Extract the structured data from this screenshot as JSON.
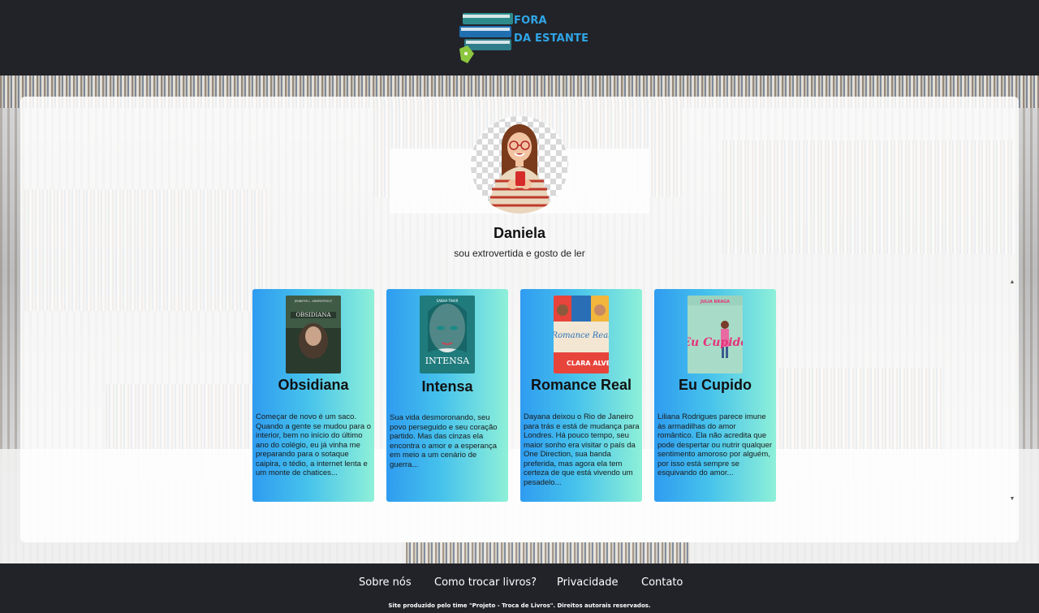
{
  "header": {
    "logo_line1": "FORA",
    "logo_line2": "DA ESTANTE"
  },
  "profile": {
    "name": "Daniela",
    "bio": "sou extrovertida e gosto de ler"
  },
  "books": [
    {
      "title": "Obsidiana",
      "description": "Começar de novo é um saco. Quando a gente se mudou para o interior, bem no início do último ano do colégio, eu já vinha me preparando para o sotaque caipira, o tédio, a internet lenta e um monte de chatices...",
      "cover_text": "OBSIDIANA",
      "cover_subtitle": "JENNIFER L. ARMENTROUT"
    },
    {
      "title": "Intensa",
      "description": "Sua vida desmoronando, seu povo perseguido e seu coração partido. Mas das cinzas ela encontra o amor e a esperança em meio a um cenário de guerra...",
      "cover_text": "INTENSA",
      "cover_subtitle": "SABAA TAHIR"
    },
    {
      "title": "Romance Real",
      "description": "Dayana deixou o Rio de Janeiro para trás e está de mudança para Londres. Há pouco tempo, seu maior sonho era visitar o país da One Direction, sua banda preferida, mas agora ela tem certeza de que está vivendo um pesadelo...",
      "cover_text": "Romance Real",
      "cover_subtitle": "CLARA ALVES"
    },
    {
      "title": "Eu Cupido",
      "description": "Liliana Rodrigues parece imune às armadilhas do amor romântico. Ela não acredita que pode despertar ou nutrir qualquer sentimento amoroso por alguém, por isso está sempre se esquivando do amor...",
      "cover_text": "Eu Cupido",
      "cover_subtitle": "JULIA BRAGA"
    }
  ],
  "footer": {
    "links": [
      "Sobre nós",
      "Como trocar livros?",
      "Privacidade",
      "Contato"
    ],
    "note": "Site produzido pelo time \"Projeto - Troca de Livros\". Direitos autorais reservados."
  },
  "colors": {
    "header_bg": "#222329",
    "logo_blue": "#2fa6e6",
    "card_gradient_start": "#2f9cf0",
    "card_gradient_end": "#8ef0d8"
  }
}
